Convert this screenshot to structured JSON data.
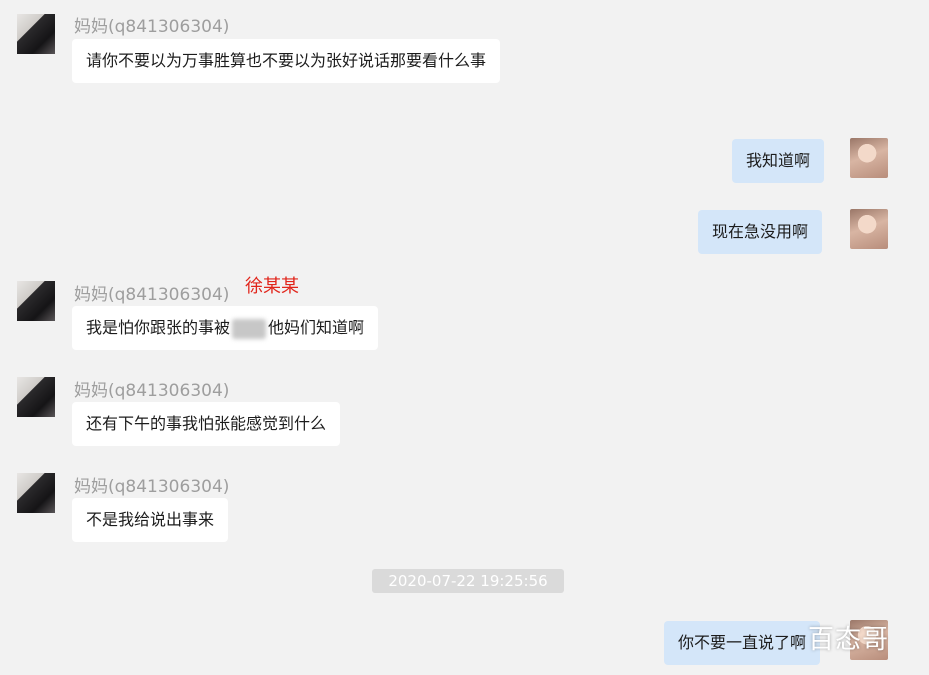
{
  "messages": [
    {
      "side": "left",
      "sender": "妈妈(q841306304)",
      "text": "请你不要以为万事胜算也不要以为张好说话那要看什么事"
    },
    {
      "side": "right",
      "text": "我知道啊"
    },
    {
      "side": "right",
      "text": "现在急没用啊"
    },
    {
      "side": "left",
      "sender": "妈妈(q841306304)",
      "annotation": "徐某某",
      "text_before": "我是怕你跟张的事被",
      "text_after": "他妈们知道啊"
    },
    {
      "side": "left",
      "sender": "妈妈(q841306304)",
      "text": "还有下午的事我怕张能感觉到什么"
    },
    {
      "side": "left",
      "sender": "妈妈(q841306304)",
      "text": "不是我给说出事来"
    },
    {
      "side": "right",
      "text": "你不要一直说了啊"
    }
  ],
  "timestamp": "2020-07-22 19:25:56",
  "watermark": "百态哥"
}
